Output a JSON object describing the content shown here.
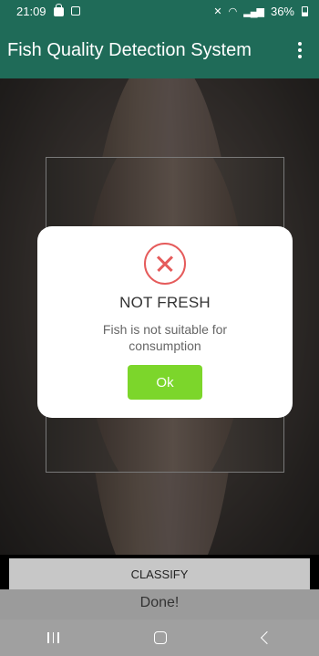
{
  "status_bar": {
    "time": "21:09",
    "battery_text": "36%"
  },
  "app_bar": {
    "title": "Fish Quality Detection System"
  },
  "dialog": {
    "title": "NOT FRESH",
    "message": "Fish is not suitable for consumption",
    "ok_label": "Ok",
    "icon": "error-circle-x-icon",
    "accent_color": "#e55b5b",
    "button_color": "#7cd62b"
  },
  "main": {
    "classify_label": "CLASSIFY",
    "status_text": "Done!"
  },
  "colors": {
    "primary": "#1f6b58"
  }
}
